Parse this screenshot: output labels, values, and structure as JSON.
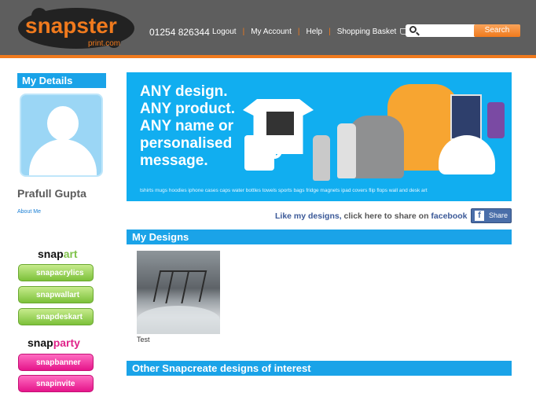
{
  "header": {
    "brand": "snapster",
    "brand_sub": "print.com",
    "phone": "01254 826344",
    "nav": [
      {
        "label": "Logout"
      },
      {
        "label": "My Account"
      },
      {
        "label": "Help"
      },
      {
        "label": "Shopping Basket"
      }
    ],
    "search_placeholder": "",
    "search_button": "Search"
  },
  "sidebar": {
    "section_title": "My Details",
    "user_name": "Prafull Gupta",
    "about_link": "About Me",
    "snapart_prefix": "snap",
    "snapart_suffix": "art",
    "snapart_buttons": [
      {
        "label": "snapacrylics"
      },
      {
        "label": "snapwallart"
      },
      {
        "label": "snapdeskart"
      }
    ],
    "snapparty_prefix": "snap",
    "snapparty_suffix": "party",
    "snapparty_buttons": [
      {
        "label": "snapbanner"
      },
      {
        "label": "snapinvite"
      }
    ]
  },
  "banner": {
    "headline": "ANY design. ANY product. ANY name or personalised message.",
    "caption": "tshirts mugs hoodies iphone cases caps water bottles towels sports bags fridge magnets ipad covers flip flops wall and desk art"
  },
  "share": {
    "link_text": "Like my designs,",
    "middle_text": " click here to share on ",
    "network": "facebook",
    "button_label": "Share"
  },
  "designs": {
    "title": "My Designs",
    "items": [
      {
        "label": "Test"
      }
    ]
  },
  "other": {
    "title": "Other Snapcreate designs of interest"
  },
  "colors": {
    "accent_orange": "#f07a1d",
    "header_grey": "#5e5e5e",
    "bar_blue": "#1aa3e8",
    "facebook_blue": "#4a6ea9"
  }
}
